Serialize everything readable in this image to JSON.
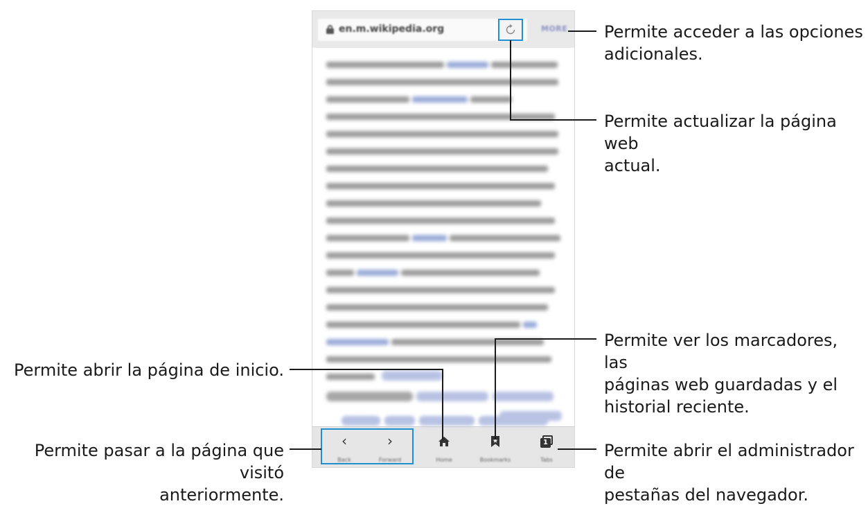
{
  "browser": {
    "url": "en.m.wikipedia.org",
    "more_label": "MORE",
    "toolbar": {
      "back_label": "Back",
      "forward_label": "Forward",
      "home_label": "Home",
      "bookmarks_label": "Bookmarks",
      "tabs_label": "Tabs",
      "tabs_count": "1"
    },
    "icons": [
      "lock-icon",
      "refresh-icon",
      "back-arrow-icon",
      "forward-arrow-icon",
      "home-icon",
      "bookmark-icon",
      "tabs-icon"
    ]
  },
  "callouts": {
    "more": [
      "Permite acceder a las opciones",
      "adicionales."
    ],
    "refresh": [
      "Permite actualizar la página web",
      "actual."
    ],
    "bookmarks": [
      "Permite ver los marcadores, las",
      "páginas web guardadas y el",
      "historial reciente."
    ],
    "tabs": [
      "Permite abrir el administrador de",
      "pestañas del navegador."
    ],
    "home": [
      "Permite abrir la página de inicio."
    ],
    "back": [
      "Permite pasar a la página que visitó",
      "anteriormente."
    ]
  },
  "colors": {
    "highlight": "#1f8fd1",
    "toolbar_bg": "#e6e6e6",
    "callout_text": "#1a1a1a"
  }
}
